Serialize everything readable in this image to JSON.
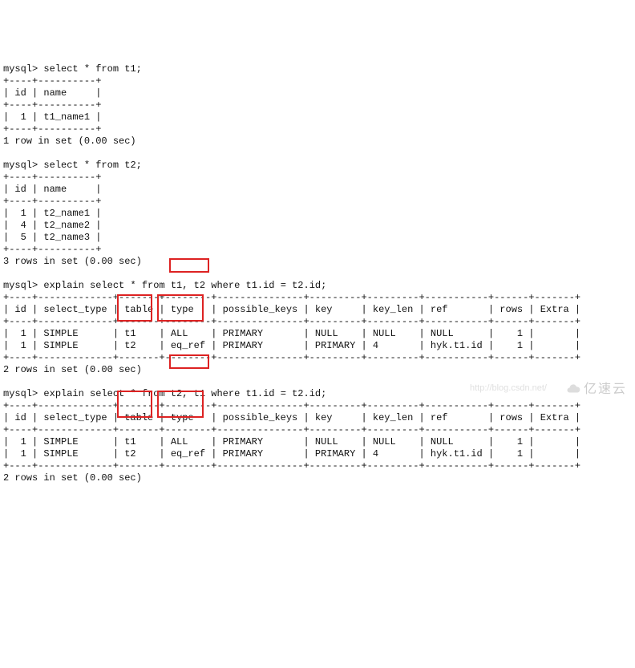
{
  "prompt": "mysql>",
  "q1": {
    "cmd": "select * from t1;",
    "sep": "+----+----------+",
    "hdr": "| id | name     |",
    "rows": [
      "|  1 | t1_name1 |"
    ],
    "footer": "1 row in set (0.00 sec)"
  },
  "q2": {
    "cmd": "select * from t2;",
    "sep": "+----+----------+",
    "hdr": "| id | name     |",
    "rows": [
      "|  1 | t2_name1 |",
      "|  4 | t2_name2 |",
      "|  5 | t2_name3 |"
    ],
    "footer": "3 rows in set (0.00 sec)"
  },
  "e1": {
    "cmd_pre": "explain select * from ",
    "cmd_mid": "t1, t2",
    "cmd_post": " where t1.id = t2.id;",
    "sep": "+----+-------------+-------+--------+---------------+---------+---------+-----------+------+-------+",
    "hdr": "| id | select_type | table | type   | possible_keys | key     | key_len | ref       | rows | Extra |",
    "rows": [
      "|  1 | SIMPLE      | t1    | ALL    | PRIMARY       | NULL    | NULL    | NULL      |    1 |       |",
      "|  1 | SIMPLE      | t2    | eq_ref | PRIMARY       | PRIMARY | 4       | hyk.t1.id |    1 |       |"
    ],
    "footer": "2 rows in set (0.00 sec)"
  },
  "e2": {
    "cmd_pre": "explain select * from ",
    "cmd_mid": "t2, t1",
    "cmd_post": " where t1.id = t2.id;",
    "sep": "+----+-------------+-------+--------+---------------+---------+---------+-----------+------+-------+",
    "hdr": "| id | select_type | table | type   | possible_keys | key     | key_len | ref       | rows | Extra |",
    "rows": [
      "|  1 | SIMPLE      | t1    | ALL    | PRIMARY       | NULL    | NULL    | NULL      |    1 |       |",
      "|  1 | SIMPLE      | t2    | eq_ref | PRIMARY       | PRIMARY | 4       | hyk.t1.id |    1 |       |"
    ],
    "footer": "2 rows in set (0.00 sec)"
  },
  "wm": {
    "url": "http://blog.csdn.net/",
    "text": "亿速云"
  }
}
